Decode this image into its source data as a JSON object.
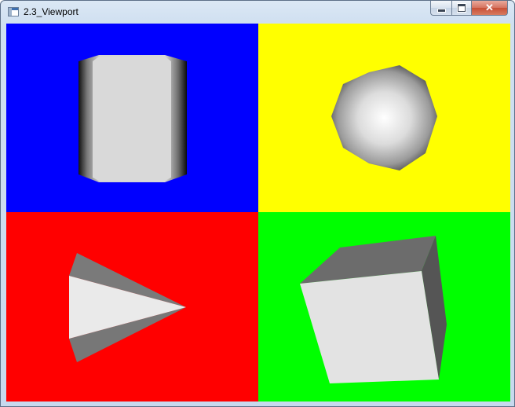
{
  "window": {
    "title": "2.3_Viewport",
    "icon": "application-window-icon",
    "controls": {
      "minimize_icon": "minimize-icon",
      "maximize_icon": "maximize-icon",
      "close_icon": "close-icon",
      "close_glyph": "✕"
    }
  },
  "viewports": [
    {
      "position": "top-left",
      "background": "#0000ff",
      "shape": "cylinder"
    },
    {
      "position": "top-right",
      "background": "#ffff00",
      "shape": "sphere"
    },
    {
      "position": "bottom-left",
      "background": "#ff0000",
      "shape": "cone"
    },
    {
      "position": "bottom-right",
      "background": "#00ff00",
      "shape": "cube"
    }
  ]
}
